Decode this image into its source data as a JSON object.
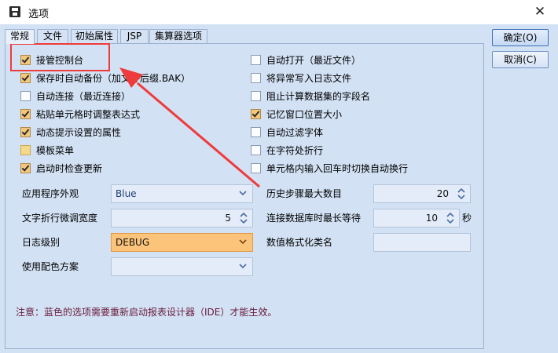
{
  "window": {
    "title": "选项",
    "close_glyph": "✕"
  },
  "tabs": [
    {
      "label": "常规"
    },
    {
      "label": "文件"
    },
    {
      "label": "初始属性"
    },
    {
      "label": "JSP"
    },
    {
      "label": "集算器选项"
    }
  ],
  "buttons": {
    "ok": "确定(O)",
    "cancel": "取消(C)"
  },
  "left_options": [
    {
      "label": "接管控制台",
      "checked": true
    },
    {
      "label": "保存时自动备份（加文件后缀.BAK）",
      "checked": true
    },
    {
      "label": "自动连接（最近连接）",
      "checked": false
    },
    {
      "label": "粘贴单元格时调整表达式",
      "checked": true
    },
    {
      "label": "动态提示设置的属性",
      "checked": true
    },
    {
      "label": "模板菜单",
      "checked": "partial"
    },
    {
      "label": "启动时检查更新",
      "checked": true
    }
  ],
  "right_options": [
    {
      "label": "自动打开（最近文件）",
      "checked": false
    },
    {
      "label": "将异常写入日志文件",
      "checked": false
    },
    {
      "label": "阻止计算数据集的字段名",
      "checked": false
    },
    {
      "label": "记忆窗口位置大小",
      "checked": true
    },
    {
      "label": "自动过滤字体",
      "checked": false
    },
    {
      "label": "在字符处折行",
      "checked": false
    },
    {
      "label": "单元格内输入回车时切换自动换行",
      "checked": false
    }
  ],
  "fields": {
    "appearance": {
      "label": "应用程序外观",
      "value": "Blue"
    },
    "wrap_width": {
      "label": "文字折行微调宽度",
      "value": "5"
    },
    "log_level": {
      "label": "日志级别",
      "value": "DEBUG"
    },
    "color_scheme": {
      "label": "使用配色方案",
      "value": ""
    },
    "undo_steps": {
      "label": "历史步骤最大数目",
      "value": "20"
    },
    "db_wait": {
      "label": "连接数据库时最长等待",
      "value": "10",
      "unit": "秒"
    },
    "number_format": {
      "label": "数值格式化类名",
      "value": ""
    }
  },
  "note": "注意：蓝色的选项需要重新启动报表设计器（IDE）才能生效。",
  "colors": {
    "background": "#d2e1f4",
    "highlight": "#ef3b3b",
    "checked": "#f5c77c",
    "note_text": "#6a1b3a"
  }
}
